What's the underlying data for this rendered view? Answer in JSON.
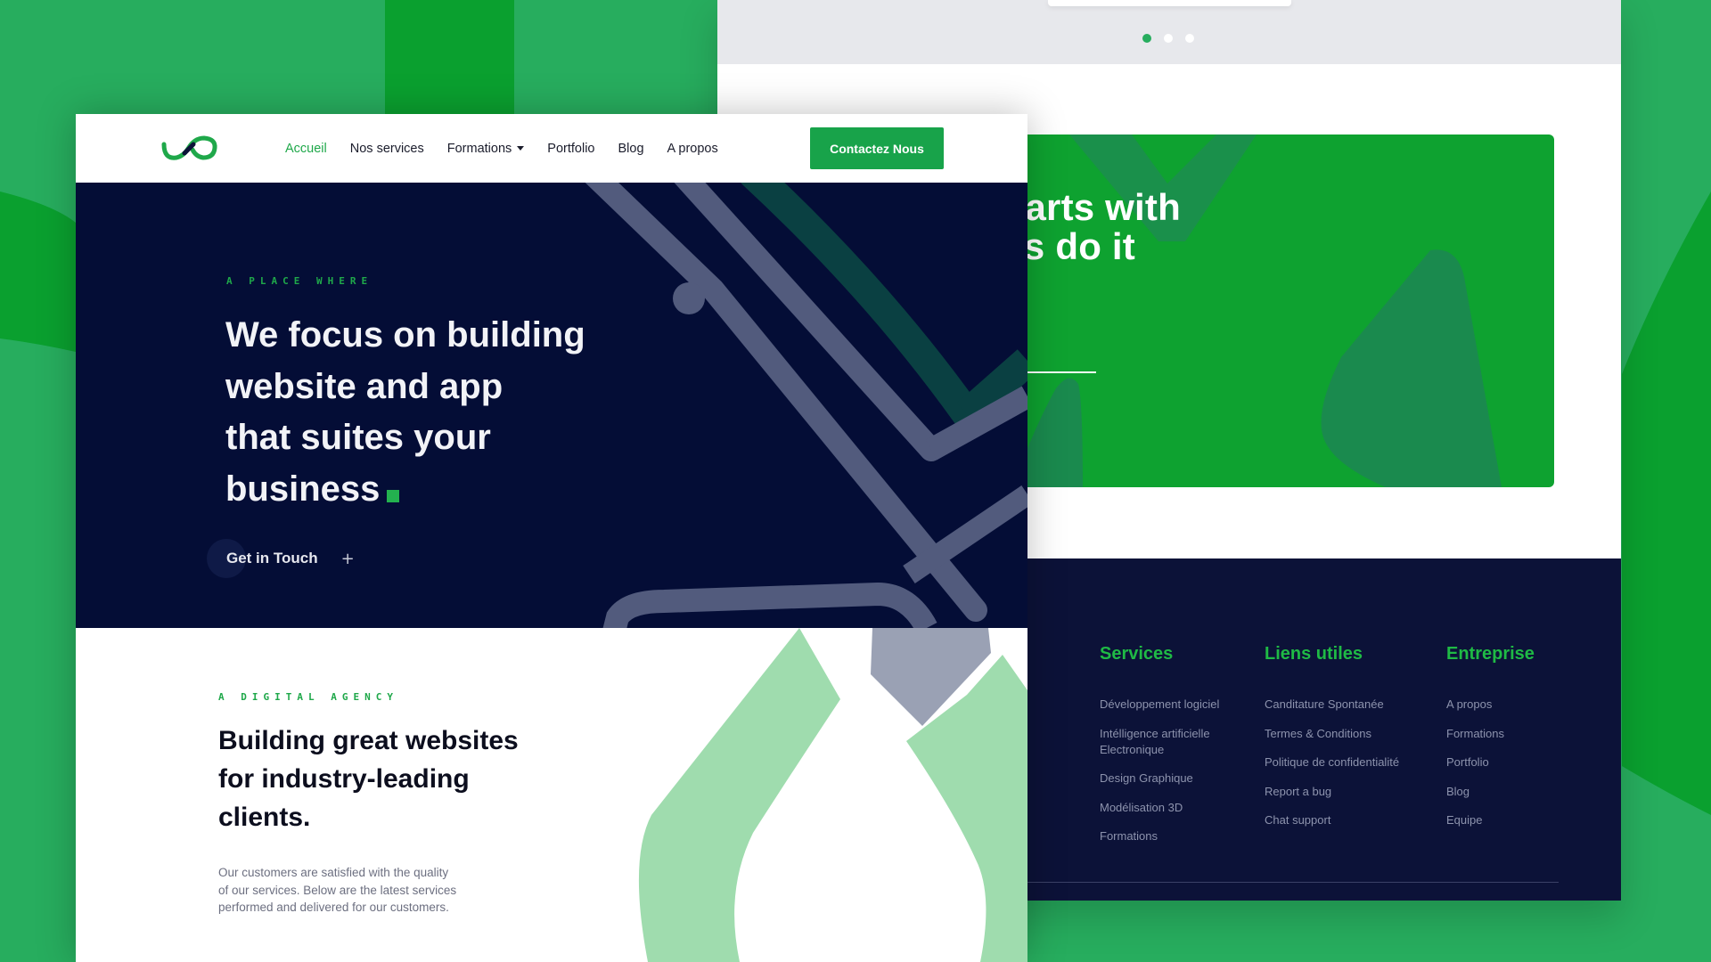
{
  "colors": {
    "brand_green": "#18a34a",
    "navy": "#040d36",
    "footer_navy": "#0c1238",
    "background_green": "#27ad5e"
  },
  "header": {
    "logo_icon": "infinity-logo-icon",
    "nav": [
      {
        "label": "Accueil",
        "active": true
      },
      {
        "label": "Nos services",
        "active": false
      },
      {
        "label": "Formations",
        "active": false,
        "dropdown": true
      },
      {
        "label": "Portfolio",
        "active": false
      },
      {
        "label": "Blog",
        "active": false
      },
      {
        "label": "A propos",
        "active": false
      }
    ],
    "cta_label": "Contactez Nous"
  },
  "hero": {
    "eyebrow": "A PLACE WHERE",
    "title_lines": [
      "We focus on building",
      "website and app",
      "that suites your",
      "business"
    ],
    "cta_label": "Get in Touch",
    "cta_icon": "plus-icon"
  },
  "about": {
    "eyebrow": "A DIGITAL AGENCY",
    "title_lines": [
      "Building great websites",
      "for industry-leading",
      "clients."
    ],
    "body": "Our customers are satisfied with the quality of our services. Below are the latest services performed and delivered for our customers."
  },
  "carousel": {
    "total_dots": 3,
    "active_index": 0
  },
  "promo": {
    "line1": "g starts with",
    "line2": "Let’s do it"
  },
  "footer": {
    "columns": [
      {
        "title": "Services",
        "links": [
          "Développement logiciel",
          "Intélligence artificielle Electronique",
          "Design Graphique",
          "Modélisation 3D",
          "Formations"
        ]
      },
      {
        "title": "Liens utiles",
        "links": [
          "Canditature Spontanée",
          "Termes & Conditions",
          "Politique de confidentialité",
          "Report a bug",
          "Chat support"
        ]
      },
      {
        "title": "Entreprise",
        "links": [
          "A propos",
          "Formations",
          "Portfolio",
          "Blog",
          "Equipe"
        ]
      }
    ]
  }
}
